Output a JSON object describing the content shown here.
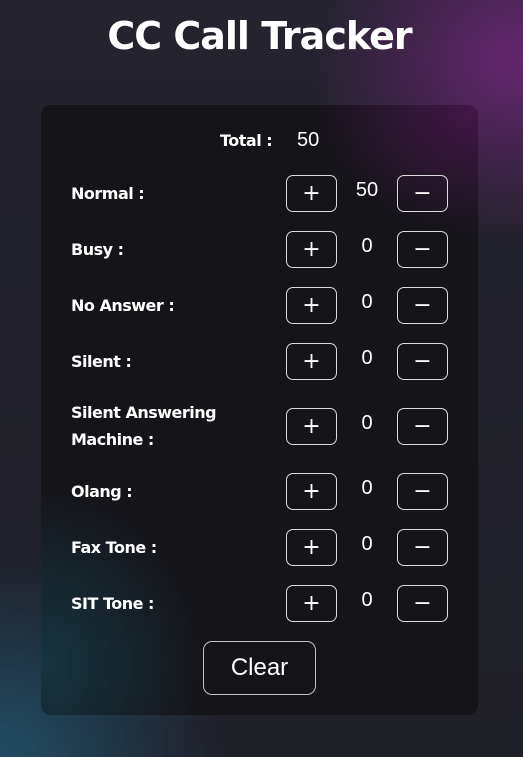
{
  "app": {
    "title": "CC Call Tracker"
  },
  "total": {
    "label": "Total :",
    "value": "50"
  },
  "rows": [
    {
      "label": "Normal :",
      "count": "50",
      "plus": "+",
      "minus": "−"
    },
    {
      "label": "Busy :",
      "count": "0",
      "plus": "+",
      "minus": "−"
    },
    {
      "label": "No Answer :",
      "count": "0",
      "plus": "+",
      "minus": "−"
    },
    {
      "label": "Silent :",
      "count": "0",
      "plus": "+",
      "minus": "−"
    },
    {
      "label_line1": "Silent Answering",
      "label_line2": "Machine :",
      "count": "0",
      "plus": "+",
      "minus": "−"
    },
    {
      "label": "Olang :",
      "count": "0",
      "plus": "+",
      "minus": "−"
    },
    {
      "label": "Fax Tone :",
      "count": "0",
      "plus": "+",
      "minus": "−"
    },
    {
      "label": "SIT Tone :",
      "count": "0",
      "plus": "+",
      "minus": "−"
    }
  ],
  "actions": {
    "clear_label": "Clear"
  },
  "colors": {
    "background": "#1f1e29",
    "card": "#151419",
    "accent_purple": "#782882",
    "accent_teal": "#23556e",
    "text": "#ffffff"
  }
}
